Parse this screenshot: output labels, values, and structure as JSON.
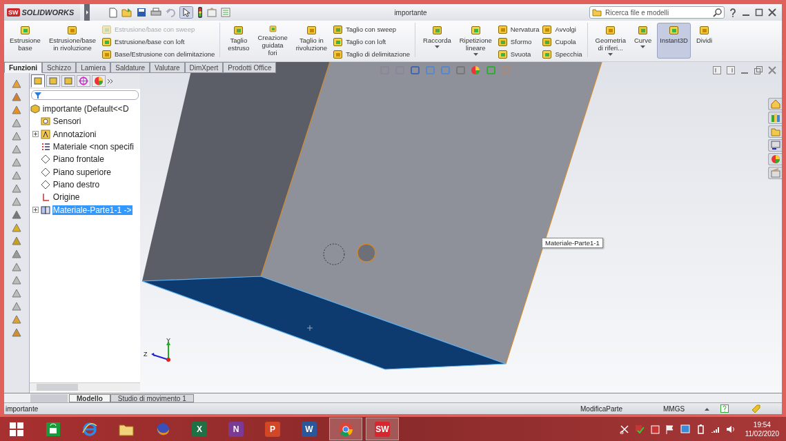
{
  "title_bar": {
    "logo_glyph": "SW",
    "app_name": "SOLIDWORKS",
    "document_title": "importante",
    "search": {
      "placeholder": "Ricerca file e modelli"
    }
  },
  "ribbon": [
    {
      "kind": "large",
      "label": "Estrusione\nbase"
    },
    {
      "kind": "large",
      "label": "Estrusione/base\nin rivoluzione"
    },
    {
      "kind": "stack",
      "items": [
        {
          "label": "Estrusione/base con sweep",
          "disabled": true
        },
        {
          "label": "Estrusione/base con loft",
          "disabled": false
        },
        {
          "label": "Base/Estrusione con delimitazione",
          "disabled": false
        }
      ]
    },
    {
      "kind": "separator"
    },
    {
      "kind": "large",
      "label": "Taglio\nestruso"
    },
    {
      "kind": "large",
      "label": "Creazione\nguidata\nfori"
    },
    {
      "kind": "large",
      "label": "Taglio in\nrivoluzione"
    },
    {
      "kind": "stack",
      "items": [
        {
          "label": "Taglio con sweep",
          "disabled": false
        },
        {
          "label": "Taglio con loft",
          "disabled": false
        },
        {
          "label": "Taglio di delimitazione",
          "disabled": false
        }
      ]
    },
    {
      "kind": "separator"
    },
    {
      "kind": "large",
      "label": "Raccorda",
      "dropdown": true
    },
    {
      "kind": "large",
      "label": "Ripetizione\nlineare",
      "dropdown": true
    },
    {
      "kind": "stack",
      "items": [
        {
          "label": "Nervatura",
          "disabled": false
        },
        {
          "label": "Sformo",
          "disabled": false
        },
        {
          "label": "Svuota",
          "disabled": false
        }
      ]
    },
    {
      "kind": "stack",
      "items": [
        {
          "label": "Avvolgi",
          "disabled": false
        },
        {
          "label": "Cupola",
          "disabled": false
        },
        {
          "label": "Specchia",
          "disabled": false
        }
      ]
    },
    {
      "kind": "separator"
    },
    {
      "kind": "large",
      "label": "Geometria\ndi riferi...",
      "dropdown": true
    },
    {
      "kind": "large",
      "label": "Curve",
      "dropdown": true
    },
    {
      "kind": "large",
      "label": "Instant3D",
      "selected": true
    },
    {
      "kind": "large",
      "label": "Dividi",
      "selected": false
    }
  ],
  "command_tabs": [
    {
      "label": "Funzioni",
      "selected": true
    },
    {
      "label": "Schizzo",
      "selected": false
    },
    {
      "label": "Lamiera",
      "selected": false
    },
    {
      "label": "Saldature",
      "selected": false
    },
    {
      "label": "Valutare",
      "selected": false
    },
    {
      "label": "DimXpert",
      "selected": false
    },
    {
      "label": "Prodotti Office",
      "selected": false
    }
  ],
  "feature_tree": {
    "panel_tabs": [
      {
        "selected": true
      },
      {
        "selected": false
      },
      {
        "selected": false
      },
      {
        "selected": false
      },
      {
        "selected": false
      }
    ],
    "root": {
      "label": "importante  (Default<<D",
      "children": [
        {
          "label": "Sensori",
          "kind": "sensor",
          "selected": false
        },
        {
          "label": "Annotazioni",
          "kind": "annotation",
          "expanded": false,
          "selected": false
        },
        {
          "label": "Materiale <non specifi",
          "kind": "material",
          "selected": false
        },
        {
          "label": "Piano frontale",
          "kind": "plane",
          "selected": false
        },
        {
          "label": "Piano superiore",
          "kind": "plane",
          "selected": false
        },
        {
          "label": "Piano destro",
          "kind": "plane",
          "selected": false
        },
        {
          "label": "Origine",
          "kind": "origin",
          "selected": false
        },
        {
          "label": "Materiale-Parte1-1 ->",
          "kind": "body",
          "expanded": false,
          "selected": true
        }
      ]
    }
  },
  "viewport": {
    "tooltip": "Materiale-Parte1-1",
    "triad": {
      "y_label": "Y",
      "z_label": "Z"
    }
  },
  "model_tabs": [
    {
      "label": "Modello",
      "selected": true
    },
    {
      "label": "Studio di movimento 1",
      "selected": false
    }
  ],
  "status_bar": {
    "document": "importante",
    "mode": "ModificaParte",
    "units": "MMGS"
  },
  "taskbar": {
    "apps": [
      {
        "kind": "start"
      },
      {
        "kind": "store"
      },
      {
        "kind": "ie"
      },
      {
        "kind": "explorer"
      },
      {
        "kind": "firefox"
      },
      {
        "kind": "letter",
        "glyph": "X",
        "color": "#1e7145",
        "active": false
      },
      {
        "kind": "letter",
        "glyph": "N",
        "color": "#7b3a96",
        "active": false
      },
      {
        "kind": "letter",
        "glyph": "P",
        "color": "#d24726",
        "active": false
      },
      {
        "kind": "letter",
        "glyph": "W",
        "color": "#2b579a",
        "active": false
      },
      {
        "kind": "chrome",
        "active": true
      },
      {
        "kind": "letter",
        "glyph": "SW",
        "color": "#d8262e",
        "active": true
      }
    ],
    "time": "19:54",
    "date": "11/02/2020"
  }
}
